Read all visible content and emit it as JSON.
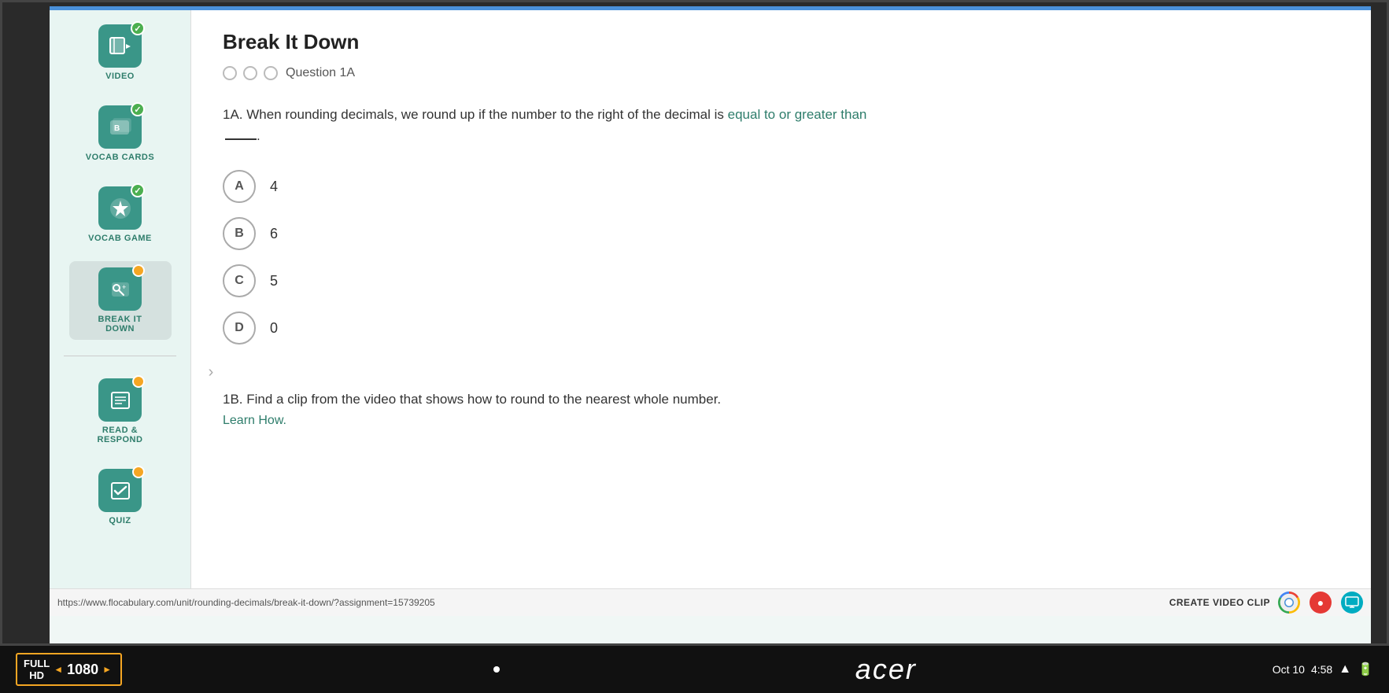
{
  "page": {
    "title": "Break It Down",
    "progress_label": "Question 1A",
    "progress_circles": [
      {
        "filled": false
      },
      {
        "filled": false
      },
      {
        "filled": false
      }
    ]
  },
  "question_1a": {
    "text_before": "1A. When rounding decimals, we round up if the number to the right of the decimal is equal to or greater than",
    "highlight_text": "equal to or greater than",
    "blank": "___."
  },
  "answers": [
    {
      "letter": "A",
      "value": "4"
    },
    {
      "letter": "B",
      "value": "6"
    },
    {
      "letter": "C",
      "value": "5"
    },
    {
      "letter": "D",
      "value": "0"
    }
  ],
  "question_1b": {
    "text": "1B. Find a clip from the video that shows how to round to the nearest whole number.",
    "link": "Learn How."
  },
  "sidebar": {
    "items": [
      {
        "label": "VIDEO",
        "icon": "▶",
        "badge": "green"
      },
      {
        "label": "VOCAB CARDS",
        "icon": "📋",
        "badge": "green"
      },
      {
        "label": "VOCAB GAME",
        "icon": "⚡",
        "badge": "green"
      },
      {
        "label": "BREAK IT DOWN",
        "icon": "🔍",
        "badge": "orange"
      },
      {
        "label": "READ & RESPOND",
        "icon": "📖",
        "badge": "orange"
      },
      {
        "label": "QUIZ",
        "icon": "✓",
        "badge": "orange"
      }
    ]
  },
  "browser": {
    "url": "https://www.flocabulary.com/unit/rounding-decimals/break-it-down/?assignment=15739205",
    "create_clip": "CREATE VIDEO CLIP"
  },
  "taskbar": {
    "date": "Oct 10",
    "time": "4:58",
    "resolution": "1080",
    "full_label": "FULL",
    "hd_label": "HD",
    "acer": "acer"
  }
}
